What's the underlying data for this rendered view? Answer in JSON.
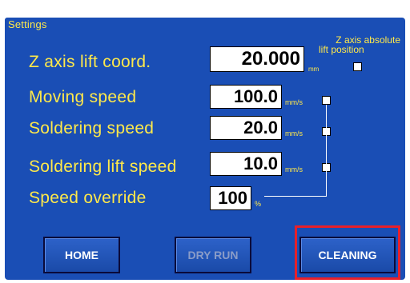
{
  "panel": {
    "title": "Settings"
  },
  "z_axis_absolute": {
    "label_line1": "Z axis absolute",
    "label_line2": "lift position",
    "checked": false
  },
  "fields": [
    {
      "label": "Z axis lift coord.",
      "value": "20.000",
      "unit": "mm"
    },
    {
      "label": "Moving speed",
      "value": "100.0",
      "unit": "mm/s"
    },
    {
      "label": "Soldering speed",
      "value": "20.0",
      "unit": "mm/s"
    },
    {
      "label": "Soldering lift speed",
      "value": "10.0",
      "unit": "mm/s"
    },
    {
      "label": "Speed override",
      "value": "100",
      "unit": "%"
    }
  ],
  "buttons": {
    "home": "HOME",
    "dry_run": "DRY RUN",
    "cleaning": "CLEANING"
  },
  "colors": {
    "background": "#1a4eb5",
    "label_text": "#ffe94a",
    "highlight": "#e8202a"
  }
}
